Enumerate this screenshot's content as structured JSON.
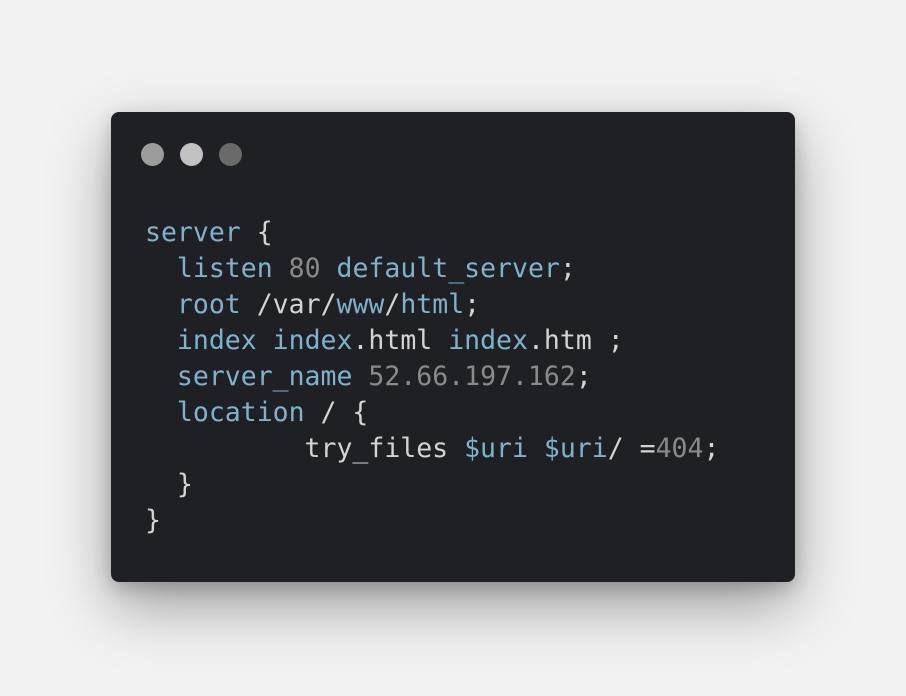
{
  "window": {
    "dots": [
      {
        "name": "window-dot-1",
        "color": "#9c9c9c"
      },
      {
        "name": "window-dot-2",
        "color": "#c2c2c2"
      },
      {
        "name": "window-dot-3",
        "color": "#6a6a6a"
      }
    ]
  },
  "colors": {
    "background": "#f2f2f2",
    "window": "#1f2023",
    "keyword": "#7fb3cc",
    "text": "#d4d4d4",
    "number": "#8a8a8a"
  },
  "code": {
    "lines": [
      [
        {
          "t": "server",
          "c": "kw"
        },
        {
          "t": " {",
          "c": "plain"
        }
      ],
      [
        {
          "t": "  ",
          "c": "plain"
        },
        {
          "t": "listen",
          "c": "kw"
        },
        {
          "t": " ",
          "c": "plain"
        },
        {
          "t": "80",
          "c": "num"
        },
        {
          "t": " ",
          "c": "plain"
        },
        {
          "t": "default_server",
          "c": "kw"
        },
        {
          "t": ";",
          "c": "plain"
        }
      ],
      [
        {
          "t": "  ",
          "c": "plain"
        },
        {
          "t": "root",
          "c": "kw"
        },
        {
          "t": " /var/",
          "c": "plain"
        },
        {
          "t": "www",
          "c": "kw"
        },
        {
          "t": "/",
          "c": "plain"
        },
        {
          "t": "html",
          "c": "kw"
        },
        {
          "t": ";",
          "c": "plain"
        }
      ],
      [
        {
          "t": "  ",
          "c": "plain"
        },
        {
          "t": "index",
          "c": "kw"
        },
        {
          "t": " ",
          "c": "plain"
        },
        {
          "t": "index",
          "c": "kw"
        },
        {
          "t": ".html ",
          "c": "plain"
        },
        {
          "t": "index",
          "c": "kw"
        },
        {
          "t": ".htm ;",
          "c": "plain"
        }
      ],
      [
        {
          "t": "  ",
          "c": "plain"
        },
        {
          "t": "server_name",
          "c": "kw"
        },
        {
          "t": " ",
          "c": "plain"
        },
        {
          "t": "52.66.197.162",
          "c": "num"
        },
        {
          "t": ";",
          "c": "plain"
        }
      ],
      [
        {
          "t": "  ",
          "c": "plain"
        },
        {
          "t": "location",
          "c": "kw"
        },
        {
          "t": " / {",
          "c": "plain"
        }
      ],
      [
        {
          "t": "          try_files ",
          "c": "plain"
        },
        {
          "t": "$uri",
          "c": "kw"
        },
        {
          "t": " ",
          "c": "plain"
        },
        {
          "t": "$uri",
          "c": "kw"
        },
        {
          "t": "/ =",
          "c": "plain"
        },
        {
          "t": "404",
          "c": "num"
        },
        {
          "t": ";",
          "c": "plain"
        }
      ],
      [
        {
          "t": "  }",
          "c": "plain"
        }
      ],
      [
        {
          "t": "}",
          "c": "plain"
        }
      ]
    ]
  }
}
